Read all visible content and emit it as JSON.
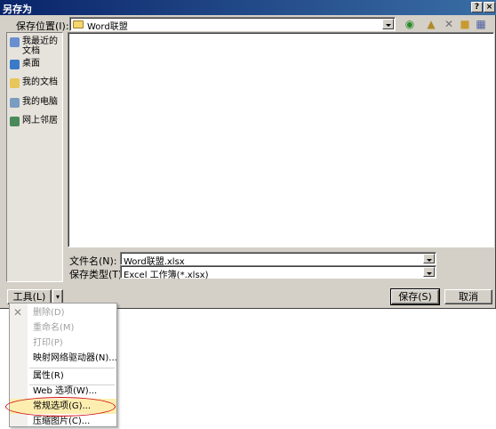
{
  "window": {
    "title": "另存为",
    "help_btn": "?",
    "close_btn": "×"
  },
  "location": {
    "label": "保存位置(I):",
    "value": "Word联盟"
  },
  "toolbar_icons": [
    "back-icon",
    "up-folder-icon",
    "delete-icon",
    "new-folder-icon",
    "views-icon"
  ],
  "places": [
    {
      "label": "我最近的文档",
      "icon": "recent-icon",
      "color": "#6a8fd0"
    },
    {
      "label": "桌面",
      "icon": "desktop-icon",
      "color": "#3a7bc8"
    },
    {
      "label": "我的文档",
      "icon": "mydocs-icon",
      "color": "#e8c65a"
    },
    {
      "label": "我的电脑",
      "icon": "computer-icon",
      "color": "#7a9cc0"
    },
    {
      "label": "网上邻居",
      "icon": "network-icon",
      "color": "#4a8a5a"
    }
  ],
  "filename": {
    "label": "文件名(N):",
    "value": "Word联盟.xlsx"
  },
  "filetype": {
    "label": "保存类型(T):",
    "value": "Excel 工作簿(*.xlsx)"
  },
  "buttons": {
    "tools": "工具(L)",
    "save": "保存(S)",
    "cancel": "取消"
  },
  "tools_menu": {
    "items": [
      {
        "label": "删除(D)",
        "disabled": true
      },
      {
        "label": "重命名(M)",
        "disabled": true
      },
      {
        "label": "打印(P)",
        "disabled": true
      },
      {
        "label": "映射网络驱动器(N)...",
        "disabled": false
      },
      {
        "label": "属性(R)",
        "disabled": false
      },
      {
        "label": "Web 选项(W)...",
        "disabled": false
      },
      {
        "label": "常规选项(G)...",
        "disabled": false,
        "highlighted": true
      },
      {
        "label": "压缩图片(C)...",
        "disabled": false
      }
    ]
  }
}
